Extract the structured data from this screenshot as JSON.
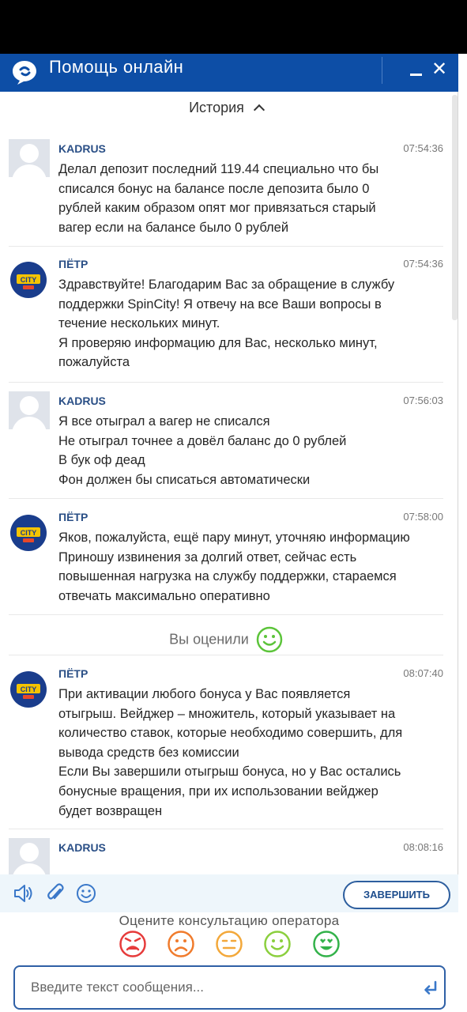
{
  "header": {
    "title": "Помощь онлайн"
  },
  "history": {
    "label": "История"
  },
  "messages": [
    {
      "author": "KADRUS",
      "time": "07:54:36",
      "lines": [
        "Делал депозит последний 119.44 специально что бы",
        "списался бонус на балансе после депозита было 0",
        "рублей каким образом опят мог привязаться старый",
        "вагер если на балансе было 0 рублей"
      ]
    },
    {
      "author": "ПЁТР",
      "time": "07:54:36",
      "lines": [
        "Здравствуйте! Благодарим Вас за обращение в службу",
        "поддержки SpinCity! Я отвечу на все Ваши вопросы в",
        "течение нескольких минут.",
        "Я проверяю информацию для Вас, несколько минут,",
        "пожалуйста"
      ]
    },
    {
      "author": "KADRUS",
      "time": "07:56:03",
      "lines": [
        "Я все отыграл а вагер не списался",
        "Не отыграл точнее а довёл баланс до 0 рублей",
        "В бук оф деад",
        "Фон должен бы списаться автоматически"
      ]
    },
    {
      "author": "ПЁТР",
      "time": "07:58:00",
      "lines": [
        "Яков, пожалуйста, ещё пару минут, уточняю информацию",
        "Приношу извинения за долгий ответ, сейчас есть",
        "повышенная нагрузка на службу поддержки, стараемся",
        "отвечать максимально оперативно"
      ]
    },
    {
      "author": "ПЁТР",
      "time": "08:07:40",
      "lines": [
        "При активации любого бонуса у Вас появляется",
        "отыгрыш. Вейджер – множитель, который указывает на",
        "количество ставок, которые необходимо совершить, для",
        "вывода средств без комиссии",
        "Если Вы завершили отыгрыш бонуса, но у Вас остались",
        "бонусные вращения, при их использовании вейджер",
        "будет возвращен"
      ]
    },
    {
      "author": "KADRUS",
      "time": "08:08:16",
      "lines": []
    }
  ],
  "rated": {
    "label": "Вы оценили"
  },
  "toolbar": {
    "finish_label": "ЗАВЕРШИТЬ"
  },
  "rating": {
    "title": "Оцените консультацию оператора"
  },
  "input": {
    "placeholder": "Введите текст сообщения..."
  },
  "colors": {
    "header_bg": "#0d4ea6",
    "accent": "#2f60a6",
    "author": "#2a4f86",
    "rated_green": "#5cc43a"
  }
}
